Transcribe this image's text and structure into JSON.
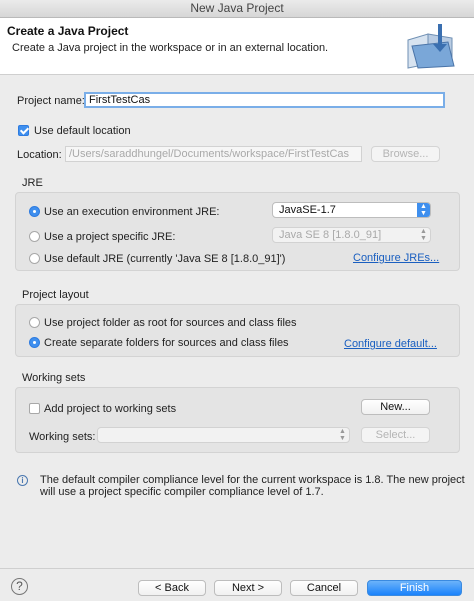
{
  "window": {
    "title": "New Java Project"
  },
  "header": {
    "title": "Create a Java Project",
    "subtitle": "Create a Java project in the workspace or in an external location.",
    "icon": "java-project-wizard-icon"
  },
  "project_name": {
    "label": "Project name:",
    "value": "FirstTestCas"
  },
  "default_location": {
    "label": "Use default location",
    "checked": true
  },
  "location": {
    "label": "Location:",
    "value": "/Users/saraddhungel/Documents/workspace/FirstTestCas",
    "browse_label": "Browse..."
  },
  "jre": {
    "title": "JRE",
    "options": [
      {
        "label": "Use an execution environment JRE:",
        "selected": true
      },
      {
        "label": "Use a project specific JRE:",
        "selected": false
      },
      {
        "label": "Use default JRE (currently 'Java SE 8 [1.8.0_91]')",
        "selected": false
      }
    ],
    "exec_env_value": "JavaSE-1.7",
    "project_jre_value": "Java SE 8 [1.8.0_91]",
    "configure_link": "Configure JREs..."
  },
  "layout": {
    "title": "Project layout",
    "options": [
      {
        "label": "Use project folder as root for sources and class files",
        "selected": false
      },
      {
        "label": "Create separate folders for sources and class files",
        "selected": true
      }
    ],
    "configure_link": "Configure default..."
  },
  "working_sets": {
    "title": "Working sets",
    "add_label": "Add project to working sets",
    "add_checked": false,
    "new_label": "New...",
    "sets_label": "Working sets:",
    "sets_value": "",
    "select_label": "Select..."
  },
  "info": {
    "line1": "The default compiler compliance level for the current workspace is 1.8. The new project",
    "line2": "will use a project specific compiler compliance level of 1.7."
  },
  "footer": {
    "help": "?",
    "back_label": "< Back",
    "next_label": "Next >",
    "cancel_label": "Cancel",
    "finish_label": "Finish"
  },
  "colors": {
    "accent": "#3f8fee",
    "link": "#1a5fc0",
    "primary_button": "#1a82fb"
  }
}
